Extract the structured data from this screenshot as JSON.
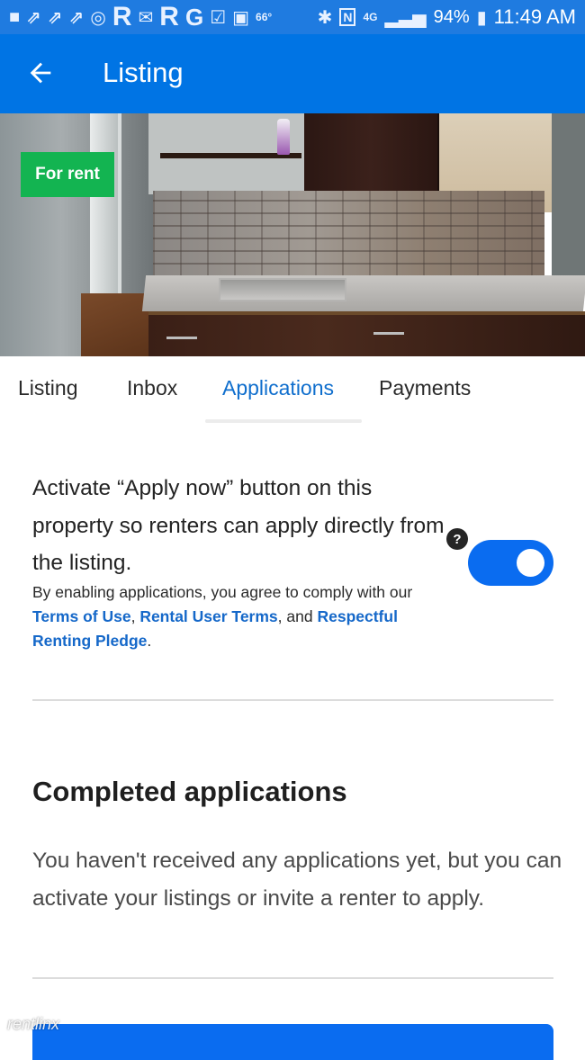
{
  "status_bar": {
    "left_icons": [
      "chat-icon",
      "zillow-icon",
      "zillow-icon",
      "zillow-icon",
      "chrome-icon",
      "r-icon",
      "mail-icon",
      "r-icon",
      "g-icon",
      "checkbox-icon",
      "image-icon"
    ],
    "temperature": "66°",
    "right_icons": [
      "bluetooth-icon",
      "nfc-icon",
      "data-4g-icon",
      "signal-icon"
    ],
    "battery": "94%",
    "time": "11:49 AM"
  },
  "app_bar": {
    "back_icon": "arrow-left-icon",
    "title": "Listing"
  },
  "hero": {
    "badge": "For rent",
    "image_alt": "Kitchen with brick backsplash and dark cabinets"
  },
  "tabs": [
    {
      "label": "Listing",
      "active": false
    },
    {
      "label": "Inbox",
      "active": false
    },
    {
      "label": "Applications",
      "active": true
    },
    {
      "label": "Payments",
      "active": false
    }
  ],
  "activate": {
    "main_text": "Activate “Apply now” button on this property so renters can apply directly from the listing.",
    "sub_prefix": "By enabling applications, you agree to comply with our ",
    "link_terms": "Terms of Use",
    "sep1": ", ",
    "link_rental": "Rental User Terms",
    "sep2": ", and ",
    "link_pledge": "Respectful Renting Pledge",
    "sub_suffix": ".",
    "help_label": "?",
    "toggle_on": true
  },
  "completed": {
    "title": "Completed applications",
    "body": "You haven't received any applications yet, but you can activate your listings or invite a renter to apply."
  },
  "watermark": "rentlinx",
  "colors": {
    "status_bar": "#1f7be0",
    "app_bar": "#0074e4",
    "accent": "#0a6cf0",
    "link": "#1568c9",
    "badge": "#13b451"
  }
}
